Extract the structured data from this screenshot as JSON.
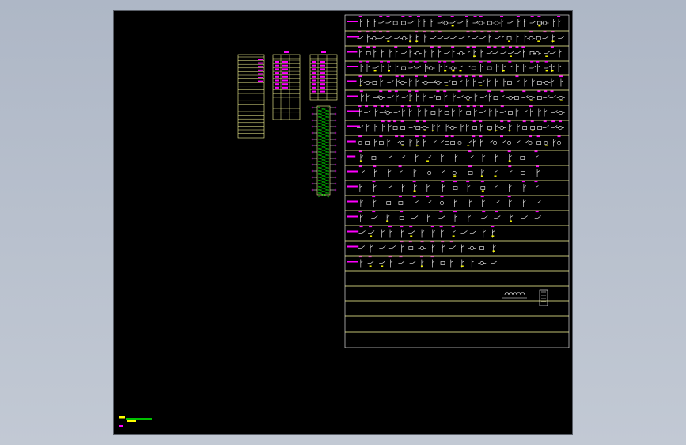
{
  "viewport": {
    "background": "#b8c0cc",
    "drawing_area_color": "#000000"
  },
  "colors": {
    "frame": "#ffff99",
    "symbol": "#ffffff",
    "label": "#ff00ff",
    "accent": "#00ff00",
    "yellow": "#ffff00"
  },
  "tables": {
    "left": {
      "title": ""
    },
    "middle": {
      "title": ""
    },
    "right": {
      "title": ""
    }
  },
  "library": {
    "rows": 22
  },
  "corner_mark": {
    "text": ""
  }
}
